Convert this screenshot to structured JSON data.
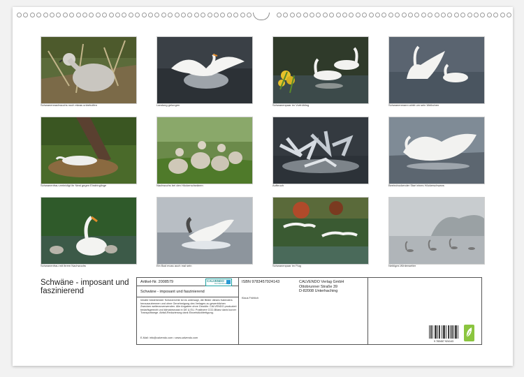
{
  "calendar_title": "Schwäne - imposant und faszinierend",
  "photos": [
    {
      "caption": "Schwanennachwuchs noch etwas unbeholfen"
    },
    {
      "caption": "Landung gelungen"
    },
    {
      "caption": "Schwanenpaar im Vorfrühling"
    },
    {
      "caption": "Schwanenmann wirbt um sein Weibchen"
    },
    {
      "caption": "Schwanenfrau verteidigt ihr Nest gegen Eindringlinge"
    },
    {
      "caption": "Nachwuchs bei den Höckerschwänen"
    },
    {
      "caption": "Aufbruch"
    },
    {
      "caption": "Beeindruckender Start eines Höckerschwans"
    },
    {
      "caption": "Schwanenfrau mit ihrem Nachwuchs"
    },
    {
      "caption": "Ein Bad muss auch mal sein"
    },
    {
      "caption": "Schwanenpaar im Flug"
    },
    {
      "caption": "Nebliges Winterwetter"
    }
  ],
  "info": {
    "article_no": "Artikel-Nr. 2008579",
    "short_title": "Schwäne - imposant und faszinierend",
    "isbn": "ISBN 9783457924143",
    "author": "Klaus Fröhlich",
    "publisher_lines": [
      "CALVENDO Verlag GmbH",
      "Ottobrunner Straße 39",
      "D-82008 Unterhaching"
    ],
    "logo_text": "CALVENDO",
    "logo_sub": "Der Kalender­verlag",
    "legal_text": "Inhalte bestehender Schutzrechte ist es untersagt, die Bilder dieses Kalenders herauszutrennen und ohne Genehmigung des Verlages zu gewerblichen Zwecken weiterzuverwenden. Alle Angaben ohne Gewähr. CALVENDO produziert bedarfsgerecht und klimabewusst in DE & EU. Positivere CO2-Bilanz dank kurzer Transportwege. Abfall-Reduzierung dank Einzelstückfertigung.",
    "email_line": "E-Mail: info@calvendo.com • www.calvendo.com",
    "barcode_number": "9 783457 924143"
  },
  "colors": {
    "page": "#ffffff",
    "background": "#f2f2f2",
    "border": "#555555",
    "calvendo_teal": "#1a8a8a",
    "green_logo": "#8bc53f"
  },
  "icons": [
    "calvendo-logo-icon",
    "barcode-icon",
    "green-leaf-logo-icon"
  ]
}
